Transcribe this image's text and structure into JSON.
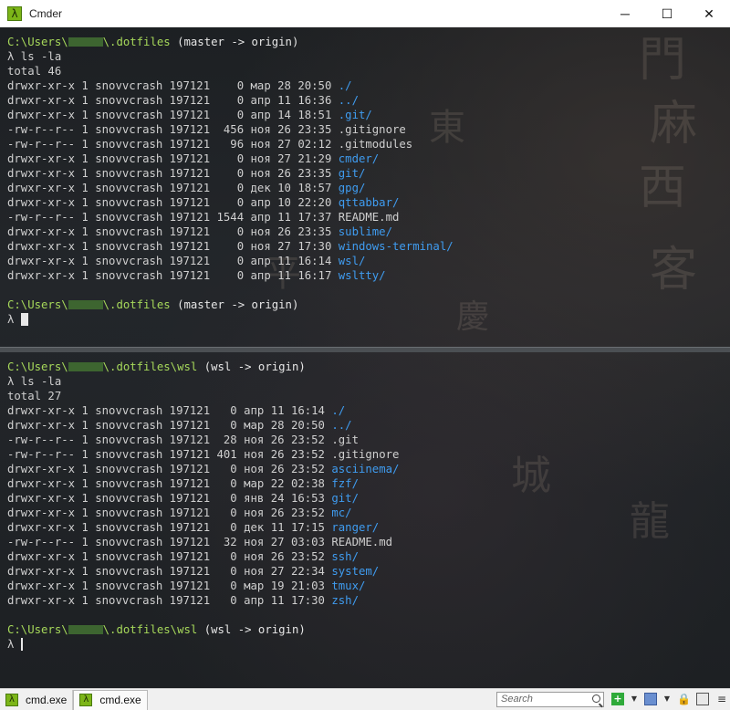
{
  "window": {
    "title": "Cmder",
    "minimize_glyph": "─",
    "maximize_glyph": "☐",
    "close_glyph": "✕",
    "icon_glyph": "λ"
  },
  "colors": {
    "path": "#a6d85a",
    "directory": "#3f9cf0",
    "text": "#cfcfcf",
    "accent": "#7cb518"
  },
  "top_pane": {
    "prompt1": {
      "prefix": "C:\\Users\\",
      "suffix": "\\.dotfiles",
      "branch": " (master -> origin)"
    },
    "command": "λ ls -la",
    "total": "total 46",
    "rows": [
      {
        "meta": "drwxr-xr-x 1 snovvcrash 197121    0 мар 28 20:50 ",
        "name": "./",
        "is_dir": true
      },
      {
        "meta": "drwxr-xr-x 1 snovvcrash 197121    0 апр 11 16:36 ",
        "name": "../",
        "is_dir": true
      },
      {
        "meta": "drwxr-xr-x 1 snovvcrash 197121    0 апр 14 18:51 ",
        "name": ".git/",
        "is_dir": true
      },
      {
        "meta": "-rw-r--r-- 1 snovvcrash 197121  456 ноя 26 23:35 ",
        "name": ".gitignore",
        "is_dir": false
      },
      {
        "meta": "-rw-r--r-- 1 snovvcrash 197121   96 ноя 27 02:12 ",
        "name": ".gitmodules",
        "is_dir": false
      },
      {
        "meta": "drwxr-xr-x 1 snovvcrash 197121    0 ноя 27 21:29 ",
        "name": "cmder/",
        "is_dir": true
      },
      {
        "meta": "drwxr-xr-x 1 snovvcrash 197121    0 ноя 26 23:35 ",
        "name": "git/",
        "is_dir": true
      },
      {
        "meta": "drwxr-xr-x 1 snovvcrash 197121    0 дек 10 18:57 ",
        "name": "gpg/",
        "is_dir": true
      },
      {
        "meta": "drwxr-xr-x 1 snovvcrash 197121    0 апр 10 22:20 ",
        "name": "qttabbar/",
        "is_dir": true
      },
      {
        "meta": "-rw-r--r-- 1 snovvcrash 197121 1544 апр 11 17:37 ",
        "name": "README.md",
        "is_dir": false
      },
      {
        "meta": "drwxr-xr-x 1 snovvcrash 197121    0 ноя 26 23:35 ",
        "name": "sublime/",
        "is_dir": true
      },
      {
        "meta": "drwxr-xr-x 1 snovvcrash 197121    0 ноя 27 17:30 ",
        "name": "windows-terminal/",
        "is_dir": true
      },
      {
        "meta": "drwxr-xr-x 1 snovvcrash 197121    0 апр 11 16:14 ",
        "name": "wsl/",
        "is_dir": true
      },
      {
        "meta": "drwxr-xr-x 1 snovvcrash 197121    0 апр 11 16:17 ",
        "name": "wsltty/",
        "is_dir": true
      }
    ],
    "prompt2": {
      "prefix": "C:\\Users\\",
      "suffix": "\\.dotfiles",
      "branch": " (master -> origin)"
    },
    "input_prompt": "λ "
  },
  "bottom_pane": {
    "prompt1": {
      "prefix": "C:\\Users\\",
      "suffix": "\\.dotfiles\\wsl",
      "branch": " (wsl -> origin)"
    },
    "command": "λ ls -la",
    "total": "total 27",
    "rows": [
      {
        "meta": "drwxr-xr-x 1 snovvcrash 197121   0 апр 11 16:14 ",
        "name": "./",
        "is_dir": true
      },
      {
        "meta": "drwxr-xr-x 1 snovvcrash 197121   0 мар 28 20:50 ",
        "name": "../",
        "is_dir": true
      },
      {
        "meta": "-rw-r--r-- 1 snovvcrash 197121  28 ноя 26 23:52 ",
        "name": ".git",
        "is_dir": false
      },
      {
        "meta": "-rw-r--r-- 1 snovvcrash 197121 401 ноя 26 23:52 ",
        "name": ".gitignore",
        "is_dir": false
      },
      {
        "meta": "drwxr-xr-x 1 snovvcrash 197121   0 ноя 26 23:52 ",
        "name": "asciinema/",
        "is_dir": true
      },
      {
        "meta": "drwxr-xr-x 1 snovvcrash 197121   0 мар 22 02:38 ",
        "name": "fzf/",
        "is_dir": true
      },
      {
        "meta": "drwxr-xr-x 1 snovvcrash 197121   0 янв 24 16:53 ",
        "name": "git/",
        "is_dir": true
      },
      {
        "meta": "drwxr-xr-x 1 snovvcrash 197121   0 ноя 26 23:52 ",
        "name": "mc/",
        "is_dir": true
      },
      {
        "meta": "drwxr-xr-x 1 snovvcrash 197121   0 дек 11 17:15 ",
        "name": "ranger/",
        "is_dir": true
      },
      {
        "meta": "-rw-r--r-- 1 snovvcrash 197121  32 ноя 27 03:03 ",
        "name": "README.md",
        "is_dir": false
      },
      {
        "meta": "drwxr-xr-x 1 snovvcrash 197121   0 ноя 26 23:52 ",
        "name": "ssh/",
        "is_dir": true
      },
      {
        "meta": "drwxr-xr-x 1 snovvcrash 197121   0 ноя 27 22:34 ",
        "name": "system/",
        "is_dir": true
      },
      {
        "meta": "drwxr-xr-x 1 snovvcrash 197121   0 мар 19 21:03 ",
        "name": "tmux/",
        "is_dir": true
      },
      {
        "meta": "drwxr-xr-x 1 snovvcrash 197121   0 апр 11 17:30 ",
        "name": "zsh/",
        "is_dir": true
      }
    ],
    "prompt2": {
      "prefix": "C:\\Users\\",
      "suffix": "\\.dotfiles\\wsl",
      "branch": " (wsl -> origin)"
    },
    "input_prompt": "λ "
  },
  "tabbar": {
    "tabs": [
      {
        "label": "cmd.exe",
        "icon": "λ",
        "active": false
      },
      {
        "label": "cmd.exe",
        "icon": "λ",
        "active": true
      }
    ],
    "search_placeholder": "Search",
    "add_glyph": "+",
    "dropdown_glyph": "▼",
    "lock_glyph": "🔒",
    "menu_glyph": "≡"
  }
}
